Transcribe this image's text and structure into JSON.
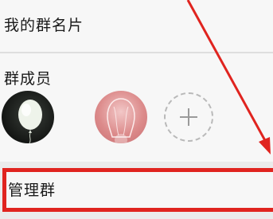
{
  "card_row": {
    "label": "我的群名片"
  },
  "members": {
    "title": "群成员",
    "avatars": [
      {
        "icon": "balloon-avatar",
        "kind": "member"
      },
      {
        "icon": "pink-glow-avatar",
        "kind": "member"
      }
    ],
    "add_icon": "plus-icon"
  },
  "manage_row": {
    "label": "管理群"
  },
  "annotation": {
    "highlight_color": "#e0241f"
  }
}
